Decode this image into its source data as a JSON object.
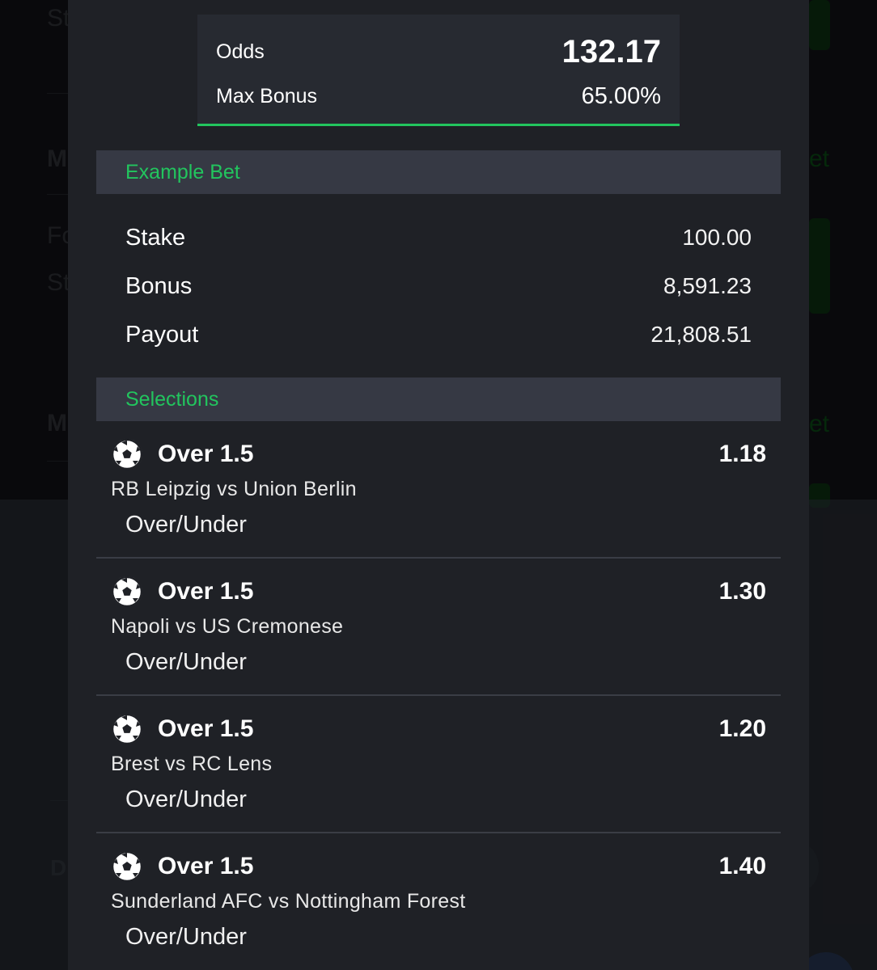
{
  "background": {
    "texts": [
      "St",
      "M",
      "Fo",
      "St",
      "M",
      "D"
    ],
    "right_texts": [
      "et",
      "et"
    ]
  },
  "odds_card": {
    "odds_label": "Odds",
    "odds_value": "132.17",
    "max_bonus_label": "Max Bonus",
    "max_bonus_value": "65.00%"
  },
  "example_bet": {
    "header": "Example Bet",
    "rows": [
      {
        "label": "Stake",
        "value": "100.00"
      },
      {
        "label": "Bonus",
        "value": "8,591.23"
      },
      {
        "label": "Payout",
        "value": "21,808.51"
      }
    ]
  },
  "selections": {
    "header": "Selections",
    "items": [
      {
        "icon": "soccer-ball-icon",
        "market": "Over 1.5",
        "odds": "1.18",
        "match": "RB Leipzig vs Union Berlin",
        "type": "Over/Under"
      },
      {
        "icon": "soccer-ball-icon",
        "market": "Over 1.5",
        "odds": "1.30",
        "match": "Napoli vs US Cremonese",
        "type": "Over/Under"
      },
      {
        "icon": "soccer-ball-icon",
        "market": "Over 1.5",
        "odds": "1.20",
        "match": "Brest vs RC Lens",
        "type": "Over/Under"
      },
      {
        "icon": "soccer-ball-icon",
        "market": "Over 1.5",
        "odds": "1.40",
        "match": "Sunderland AFC vs Nottingham Forest",
        "type": "Over/Under"
      }
    ]
  },
  "colors": {
    "accent_green": "#22c55e",
    "modal_bg": "#1f2126",
    "header_bg": "#363944"
  }
}
